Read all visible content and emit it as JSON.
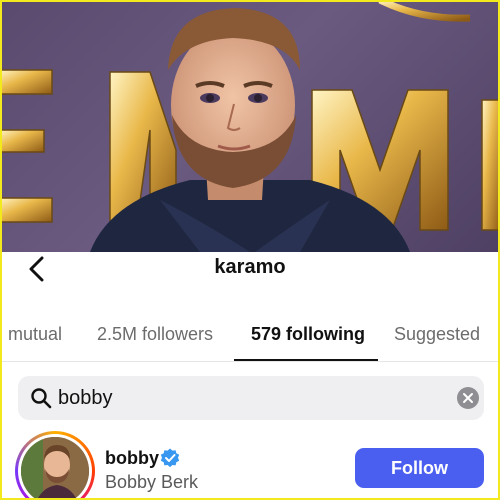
{
  "photo": {
    "description_icon": "photo-image",
    "sign_letters": "EMMY"
  },
  "header": {
    "back_icon": "chevron-left-icon",
    "username": "karamo"
  },
  "tabs": [
    {
      "label": "mutual",
      "active": false
    },
    {
      "label": "2.5M followers",
      "active": false
    },
    {
      "label": "579 following",
      "active": true
    },
    {
      "label": "Suggested",
      "active": false
    }
  ],
  "search": {
    "value": "bobby",
    "icon": "search-icon",
    "clear_icon": "clear-icon"
  },
  "result": {
    "username": "bobby",
    "full_name": "Bobby Berk",
    "verified": true,
    "follow_label": "Follow"
  },
  "colors": {
    "follow_button": "#4a5ef0",
    "verified_badge": "#3897f0",
    "frame": "#f2ea1c"
  }
}
